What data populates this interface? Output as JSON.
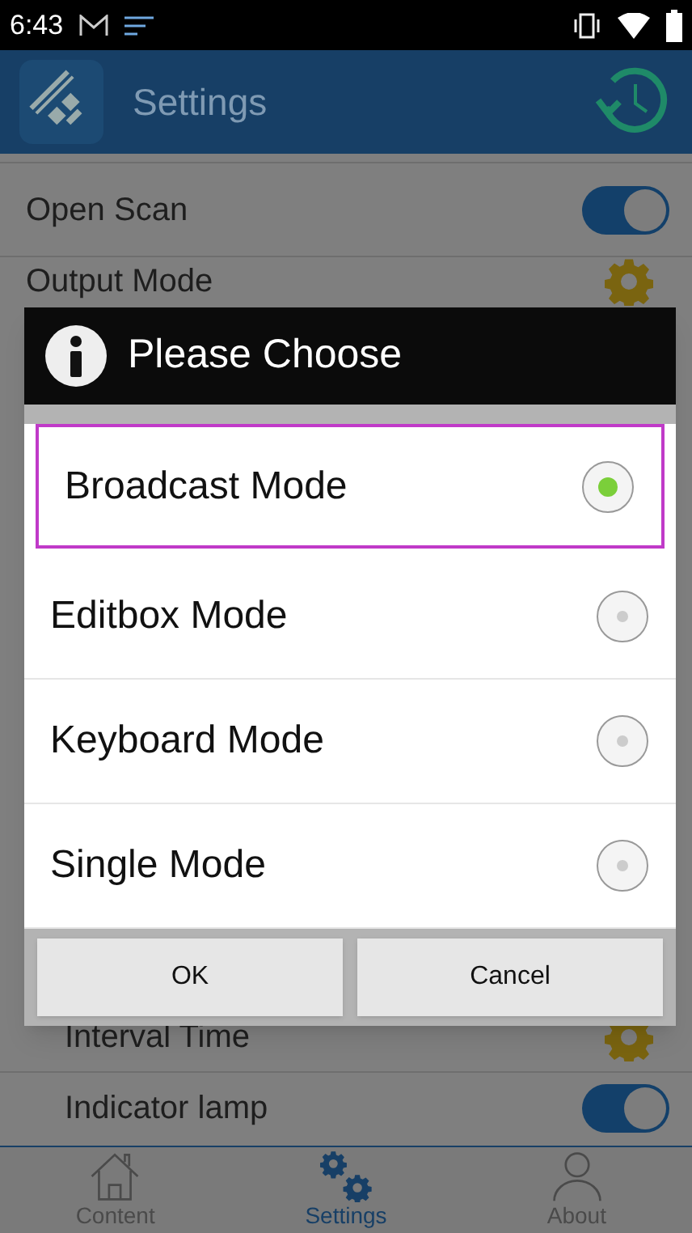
{
  "status_bar": {
    "time": "6:43"
  },
  "app_bar": {
    "title": "Settings"
  },
  "settings": [
    {
      "label": "Open Scan",
      "kind": "toggle",
      "on": true,
      "indented": false
    },
    {
      "label": "Output Mode",
      "kind": "gear",
      "indented": false
    },
    {
      "label": "Interval Time",
      "kind": "gear",
      "indented": true
    },
    {
      "label": "Indicator lamp",
      "kind": "toggle",
      "on": true,
      "indented": true
    }
  ],
  "dialog": {
    "title": "Please Choose",
    "options": [
      {
        "label": "Broadcast Mode",
        "selected": true
      },
      {
        "label": "Editbox Mode",
        "selected": false
      },
      {
        "label": "Keyboard Mode",
        "selected": false
      },
      {
        "label": "Single Mode",
        "selected": false
      }
    ],
    "buttons": [
      "OK",
      "Cancel"
    ]
  },
  "bottom_nav": [
    {
      "label": "Content",
      "kind": "home",
      "selected": false
    },
    {
      "label": "Settings",
      "kind": "gears",
      "selected": true
    },
    {
      "label": "About",
      "kind": "person",
      "selected": false
    }
  ]
}
